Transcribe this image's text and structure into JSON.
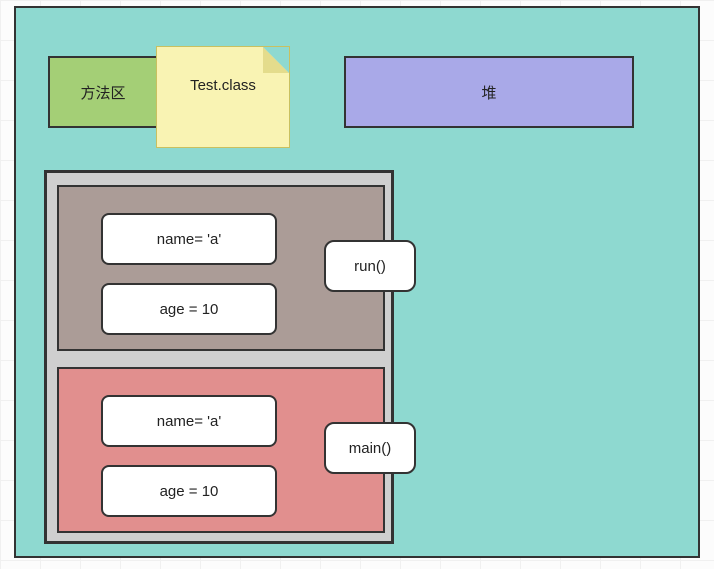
{
  "canvas": {
    "methodArea": {
      "label": "方法区"
    },
    "classNote": {
      "label": "Test.class"
    },
    "heap": {
      "label": "堆"
    }
  },
  "stack": {
    "frames": [
      {
        "id": "run",
        "callLabel": "run()",
        "fields": {
          "name": "name= 'a'",
          "age": "age = 10"
        }
      },
      {
        "id": "main",
        "callLabel": "main()",
        "fields": {
          "name": "name= 'a'",
          "age": "age = 10"
        }
      }
    ]
  }
}
